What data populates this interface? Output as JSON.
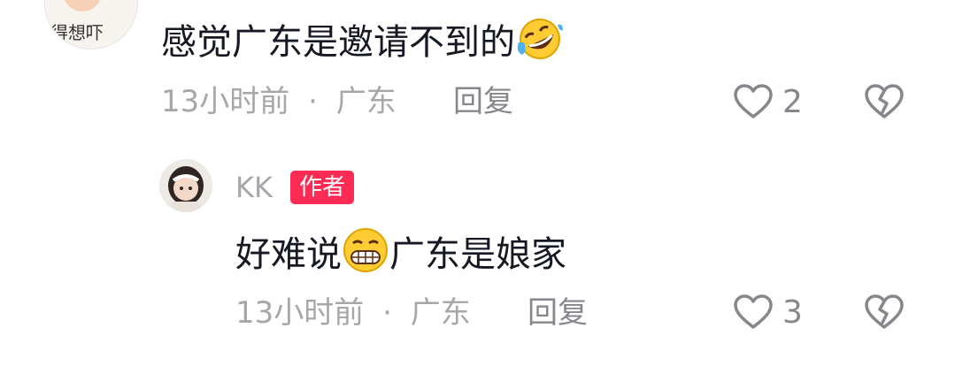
{
  "comments": [
    {
      "avatar_text": "得想吓",
      "text_before_emoji": "感觉广东是邀请不到的",
      "emoji": "rolling-laughing-emoji",
      "text_after_emoji": "",
      "time": "13小时前",
      "location": "广东",
      "separator": "·",
      "reply_label": "回复",
      "likes": "2"
    }
  ],
  "reply": {
    "username": "KK",
    "badge": "作者",
    "text_before_emoji": "好难说",
    "emoji": "grinning-emoji",
    "text_after_emoji": "广东是娘家",
    "time": "13小时前",
    "location": "广东",
    "separator": "·",
    "reply_label": "回复",
    "likes": "3"
  },
  "colors": {
    "accent": "#fe2c55",
    "text_primary": "#161823",
    "text_secondary": "#a6a7ab",
    "icon": "#86878c"
  }
}
